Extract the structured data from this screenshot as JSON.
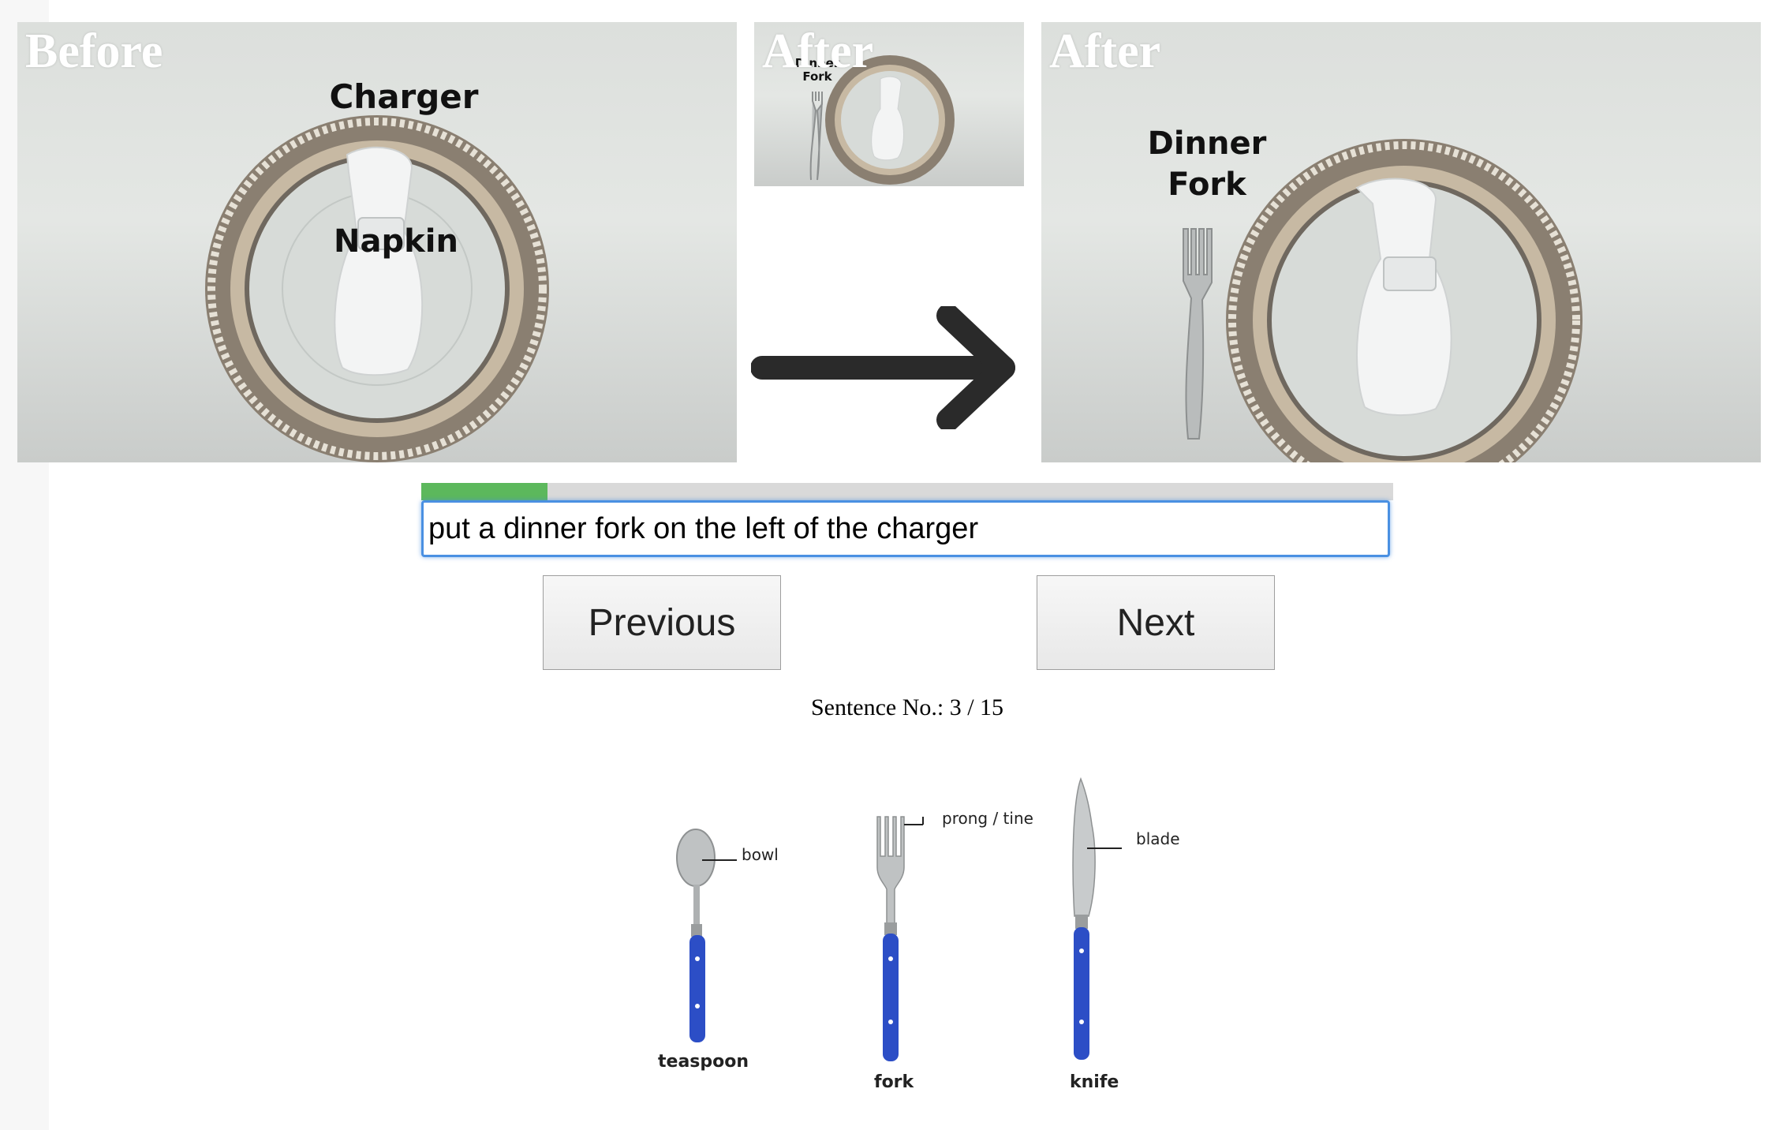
{
  "panels": [
    {
      "heading": "Before",
      "labels": [
        "Charger",
        "Napkin"
      ]
    },
    {
      "heading": "After",
      "labels": [
        "Dinner",
        "Fork"
      ]
    },
    {
      "heading": "After",
      "labels": [
        "Dinner",
        "Fork"
      ]
    }
  ],
  "progress": {
    "fraction": 0.13,
    "color": "#5cb85c",
    "track_color": "#d9d9d9"
  },
  "sentence": {
    "value": "put a dinner fork on the left of the charger"
  },
  "buttons": {
    "previous": "Previous",
    "next": "Next"
  },
  "counter": {
    "text": "Sentence No.: 3 / 15"
  },
  "cutlery": {
    "items": [
      {
        "name": "teaspoon",
        "part": "bowl"
      },
      {
        "name": "fork",
        "part": "prong / tine"
      },
      {
        "name": "knife",
        "part": "blade"
      }
    ],
    "handle_color": "#2c4ec6"
  }
}
